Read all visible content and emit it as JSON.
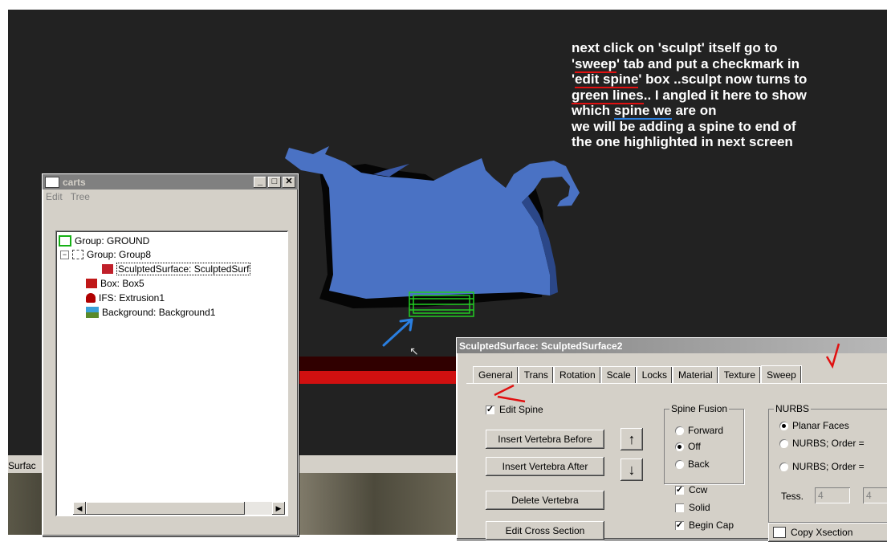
{
  "annotation_lines": [
    [
      "next click on 'sculpt' itself go to",
      "",
      ""
    ],
    [
      "'",
      "sweep",
      "' tab and put a checkmark in"
    ],
    [
      "'",
      "edit spine",
      "' box ..sculpt now turns to"
    ],
    [
      "",
      "green lines",
      ".. I angled it here to show"
    ],
    [
      "which ",
      "spine we",
      " are on"
    ],
    [
      "we will be adding a spine to end of",
      "",
      ""
    ],
    [
      "the one highlighted in next screen",
      "",
      ""
    ]
  ],
  "bg_window_title_fragment": "Surfac",
  "tree_window": {
    "title": "carts",
    "menus": [
      "Edit",
      "Tree"
    ],
    "items": [
      {
        "label": "Group: GROUND",
        "icon": "group-icon"
      },
      {
        "label": "Group: Group8",
        "icon": "group-icon"
      },
      {
        "label": "SculptedSurface: SculptedSurf",
        "icon": "sculpted-surface-icon"
      },
      {
        "label": "Box: Box5",
        "icon": "box-icon"
      },
      {
        "label": "IFS: Extrusion1",
        "icon": "ifs-icon"
      },
      {
        "label": "Background: Background1",
        "icon": "background-icon"
      }
    ]
  },
  "dialog": {
    "title": "SculptedSurface: SculptedSurface2",
    "tabs": [
      "General",
      "Trans",
      "Rotation",
      "Scale",
      "Locks",
      "Material",
      "Texture",
      "Sweep"
    ],
    "active_tab": "Sweep",
    "edit_spine_label": "Edit Spine",
    "edit_spine_checked": true,
    "buttons": [
      "Insert Vertebra Before",
      "Insert Vertebra After",
      "Delete Vertebra",
      "Edit Cross Section"
    ],
    "spine_fusion": {
      "legend": "Spine Fusion",
      "options": [
        "Forward",
        "Off",
        "Back"
      ],
      "selected": "Off"
    },
    "checks": [
      {
        "label": "Ccw",
        "checked": true
      },
      {
        "label": "Solid",
        "checked": false
      },
      {
        "label": "Begin Cap",
        "checked": true
      }
    ],
    "nurbs": {
      "legend": "NURBS",
      "options": [
        "Planar Faces",
        "NURBS; Order =",
        "NURBS; Order ="
      ],
      "selected": "Planar Faces",
      "tess_label": "Tess.",
      "tess_values": [
        "4",
        "4"
      ]
    },
    "copy_button": "Copy Xsection"
  },
  "colors": {
    "viewport_bg": "#222222",
    "sculpt_blue": "#4a72c4",
    "spine_green": "#22cc22",
    "annotation_red": "#e01010",
    "annotation_blue": "#2a7fe0"
  }
}
